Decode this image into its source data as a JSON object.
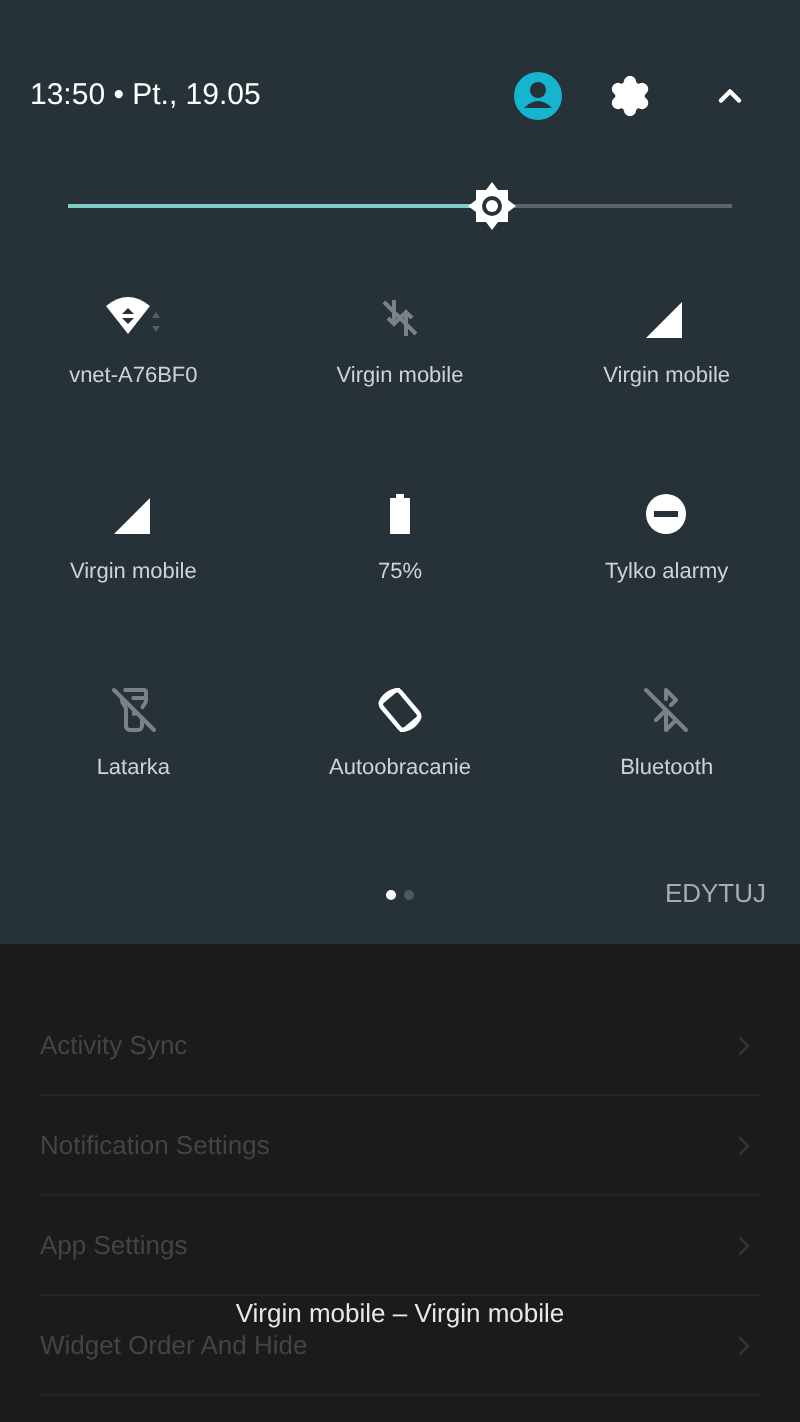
{
  "status_header": {
    "time_date": "13:50 • Pt., 19.05"
  },
  "brightness": {
    "level": 0.64
  },
  "tiles": [
    {
      "kind": "wifi",
      "label": "vnet-A76BF0",
      "on": true
    },
    {
      "kind": "data",
      "label": "Virgin mobile",
      "on": false
    },
    {
      "kind": "signal",
      "label": "Virgin mobile",
      "on": true
    },
    {
      "kind": "signal",
      "label": "Virgin mobile",
      "on": true
    },
    {
      "kind": "battery",
      "label": "75%",
      "on": true
    },
    {
      "kind": "dnd",
      "label": "Tylko alarmy",
      "on": true
    },
    {
      "kind": "flashlight",
      "label": "Latarka",
      "on": false
    },
    {
      "kind": "rotate",
      "label": "Autoobracanie",
      "on": true
    },
    {
      "kind": "bluetooth",
      "label": "Bluetooth",
      "on": false
    }
  ],
  "pages": [
    {
      "selected": true
    },
    {
      "selected": false
    }
  ],
  "edit_button": "EDYTUJ",
  "background_list": [
    "Activity Sync",
    "Notification Settings",
    "App Settings",
    "Widget Order And Hide"
  ],
  "toast": "Virgin mobile – Virgin mobile"
}
